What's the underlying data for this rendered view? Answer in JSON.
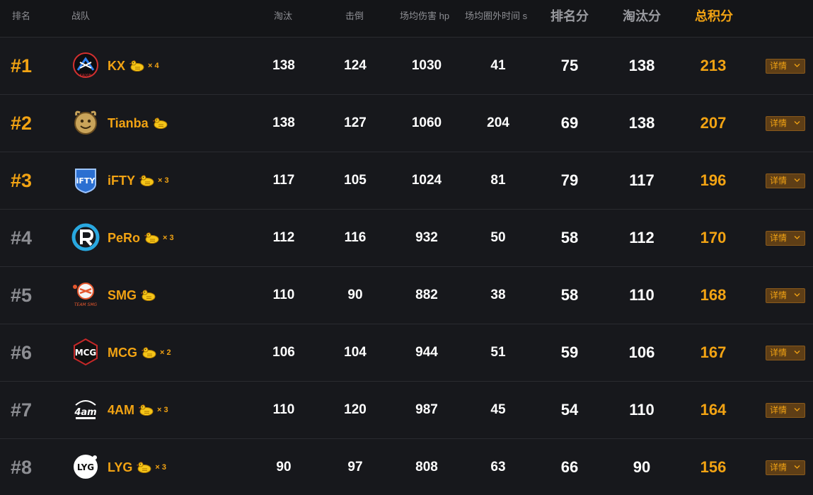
{
  "header": {
    "rank": "排名",
    "team": "战队",
    "elims": "淘汰",
    "knocks": "击倒",
    "avg_damage": "场均伤害 hp",
    "avg_outside": "场均圈外时间 s",
    "place_pts": "排名分",
    "elim_pts": "淘汰分",
    "total_pts": "总积分"
  },
  "detail_label": "详情",
  "colors": {
    "gold": "#f2a313",
    "grey_rank": "#8d8e93",
    "background": "#17181c"
  },
  "rows": [
    {
      "rank": "#1",
      "team": "KX",
      "mult": "× 4",
      "elims": "138",
      "knocks": "124",
      "damage": "1030",
      "outside": "41",
      "place_pts": "75",
      "elim_pts": "138",
      "total": "213",
      "logo": "kx-logo"
    },
    {
      "rank": "#2",
      "team": "Tianba",
      "mult": "",
      "elims": "138",
      "knocks": "127",
      "damage": "1060",
      "outside": "204",
      "place_pts": "69",
      "elim_pts": "138",
      "total": "207",
      "logo": "tianba-logo"
    },
    {
      "rank": "#3",
      "team": "iFTY",
      "mult": "× 3",
      "elims": "117",
      "knocks": "105",
      "damage": "1024",
      "outside": "81",
      "place_pts": "79",
      "elim_pts": "117",
      "total": "196",
      "logo": "ifty-logo"
    },
    {
      "rank": "#4",
      "team": "PeRo",
      "mult": "× 3",
      "elims": "112",
      "knocks": "116",
      "damage": "932",
      "outside": "50",
      "place_pts": "58",
      "elim_pts": "112",
      "total": "170",
      "logo": "pero-logo"
    },
    {
      "rank": "#5",
      "team": "SMG",
      "mult": "",
      "elims": "110",
      "knocks": "90",
      "damage": "882",
      "outside": "38",
      "place_pts": "58",
      "elim_pts": "110",
      "total": "168",
      "logo": "smg-logo"
    },
    {
      "rank": "#6",
      "team": "MCG",
      "mult": "× 2",
      "elims": "106",
      "knocks": "104",
      "damage": "944",
      "outside": "51",
      "place_pts": "59",
      "elim_pts": "106",
      "total": "167",
      "logo": "mcg-logo"
    },
    {
      "rank": "#7",
      "team": "4AM",
      "mult": "× 3",
      "elims": "110",
      "knocks": "120",
      "damage": "987",
      "outside": "45",
      "place_pts": "54",
      "elim_pts": "110",
      "total": "164",
      "logo": "4am-logo"
    },
    {
      "rank": "#8",
      "team": "LYG",
      "mult": "× 3",
      "elims": "90",
      "knocks": "97",
      "damage": "808",
      "outside": "63",
      "place_pts": "66",
      "elim_pts": "90",
      "total": "156",
      "logo": "lyg-logo"
    }
  ]
}
